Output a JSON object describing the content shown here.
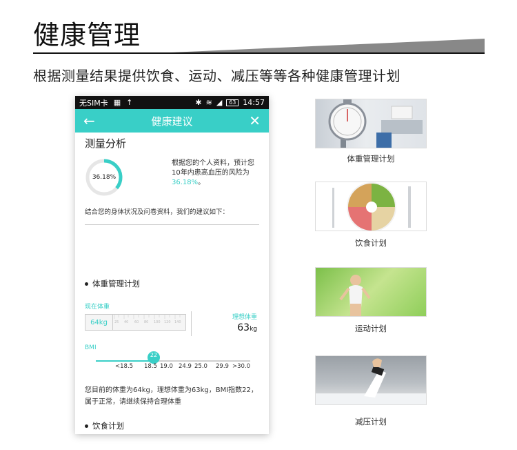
{
  "page": {
    "title": "健康管理",
    "subtitle": "根据测量结果提供饮食、运动、减压等等各种健康管理计划"
  },
  "statusbar": {
    "carrier": "无SIM卡",
    "time": "14:57",
    "battery": "63"
  },
  "appbar": {
    "title": "健康建议",
    "back_icon": "arrow-left-icon",
    "close_icon": "close-icon"
  },
  "analysis": {
    "heading": "测量分析",
    "risk_percent": "36.18%",
    "risk_fraction": 0.3618,
    "risk_text": "根据您的个人资料，预计您10年内患高血压的风险为",
    "risk_value": "36.18%",
    "risk_suffix": "。",
    "advice_intro": "结合您的身体状况及问卷资料，我们的建议如下："
  },
  "weight_plan": {
    "heading": "体重管理计划",
    "current_label": "现在体重",
    "current_value": "64kg",
    "ruler_ticks": [
      "25",
      "40",
      "60",
      "80",
      "100",
      "120",
      "140"
    ],
    "ideal_label": "理想体重",
    "ideal_value": "63",
    "ideal_unit": "kg",
    "bmi_label": "BMI",
    "bmi_value": "22",
    "bmi_ticks": [
      "<18.5",
      "18.5",
      "19.0",
      "24.9",
      "25.0",
      "29.9",
      ">30.0"
    ],
    "summary": "您目前的体重为64kg，理想体重为63kg，BMI指数22，属于正常，请继续保持合理体重"
  },
  "diet_plan": {
    "heading": "饮食计划"
  },
  "side_plans": [
    {
      "caption": "体重管理计划"
    },
    {
      "caption": "饮食计划"
    },
    {
      "caption": "运动计划"
    },
    {
      "caption": "减压计划"
    }
  ],
  "colors": {
    "accent": "#39cfc7",
    "statusbar": "#111111"
  }
}
